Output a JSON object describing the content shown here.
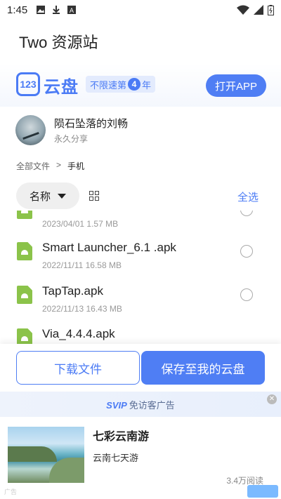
{
  "status_bar": {
    "time": "1:45"
  },
  "app_title": "Two 资源站",
  "brand": {
    "logo": "123",
    "name": "云盘",
    "badge_prefix": "不限速第",
    "badge_num": "4",
    "badge_suffix": "年",
    "open_app_label": "打开APP",
    "accent_color": "#4f7ef4"
  },
  "sharer": {
    "name": "陨石坠落的刘畅",
    "sub": "永久分享"
  },
  "breadcrumb": {
    "root": "全部文件",
    "separator": ">",
    "current": "手机"
  },
  "toolbar": {
    "sort_label": "名称",
    "select_all": "全选"
  },
  "files": [
    {
      "name": "",
      "meta": "2023/04/01 1.57 MB"
    },
    {
      "name": "Smart Launcher_6.1 .apk",
      "meta": "2022/11/11 16.58 MB"
    },
    {
      "name": "TapTap.apk",
      "meta": "2022/11/13 16.43 MB"
    },
    {
      "name": "Via_4.4.4.apk",
      "meta": ""
    }
  ],
  "actions": {
    "download": "下载文件",
    "save": "保存至我的云盘"
  },
  "ad_banner": {
    "svip": "SVIP",
    "text": "免访客广告"
  },
  "ad": {
    "title": "七彩云南游",
    "subtitle": "云南七天游",
    "reads": "3.4万阅读",
    "label": "广告"
  }
}
